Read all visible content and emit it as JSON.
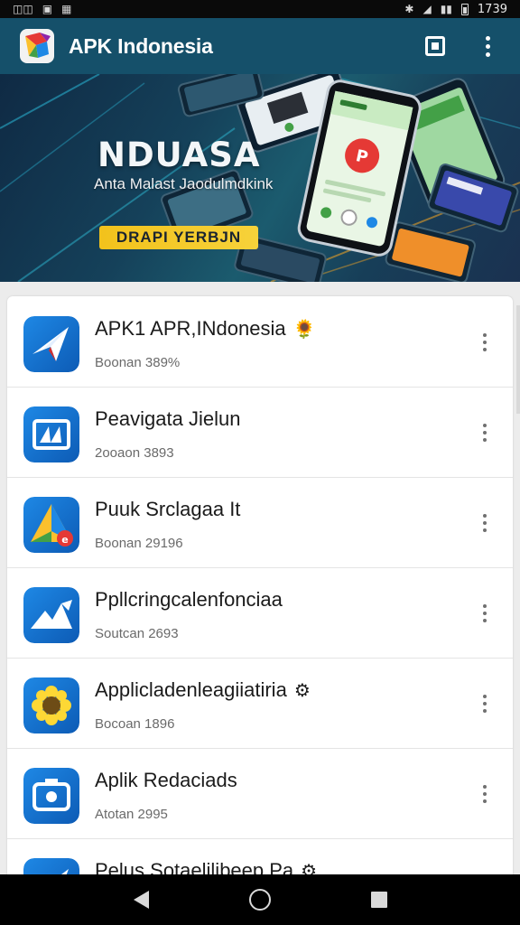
{
  "status_bar": {
    "time": "1739",
    "icons": [
      "vibrate-icon",
      "notification-icon",
      "image-icon",
      "bluetooth-icon",
      "wifi-icon",
      "signal-icon",
      "battery-icon"
    ]
  },
  "app_bar": {
    "title": "APK Indonesia",
    "actions": [
      "square-button",
      "overflow-menu"
    ]
  },
  "banner": {
    "headline": "NDUASA",
    "subline": "Anta Malast Jaodulmdkink",
    "cta_label": "DRAPI YERBJN"
  },
  "apps": [
    {
      "title": "APK1 APR,INdonesia",
      "subtitle": "Boonan 389%",
      "badge": "🌻",
      "icon": "send-arrow-icon",
      "icon_colors": [
        "#1e88e5",
        "#0d5bb5"
      ]
    },
    {
      "title": "Peavigata Jielun",
      "subtitle": "2ooaon 3893",
      "badge": "",
      "icon": "rewind-icon",
      "icon_colors": [
        "#ffb300",
        "#f4511e"
      ]
    },
    {
      "title": "Puuk Srclagaa It",
      "subtitle": "Boonan 29196",
      "badge": "",
      "icon": "triangle-logo-icon",
      "icon_colors": [
        "#3f51b5",
        "#43a047"
      ]
    },
    {
      "title": "Ppllcringcalenfonciaa",
      "subtitle": "Soutcan 2693",
      "badge": "",
      "icon": "mountain-arrow-icon",
      "icon_colors": [
        "#2979ff",
        "#1546b8"
      ]
    },
    {
      "title": "Applicladenleagiiatiria",
      "subtitle": "Bocoan 1896",
      "badge": "⚙",
      "icon": "sunflower-icon",
      "icon_colors": [
        "#43a047",
        "#2e7d32"
      ]
    },
    {
      "title": "Aplik Redaciads",
      "subtitle": "Atotan 2995",
      "badge": "",
      "icon": "camera-icon",
      "icon_colors": [
        "#e53935",
        "#c62828"
      ]
    },
    {
      "title": "Pelus Sotaeljlibeep Pa",
      "subtitle": "",
      "badge": "⚙",
      "icon": "send-arrow-icon",
      "icon_colors": [
        "#29b6f6",
        "#0288d1"
      ]
    }
  ],
  "nav_bar": {
    "buttons": [
      "back",
      "home",
      "recents"
    ]
  }
}
